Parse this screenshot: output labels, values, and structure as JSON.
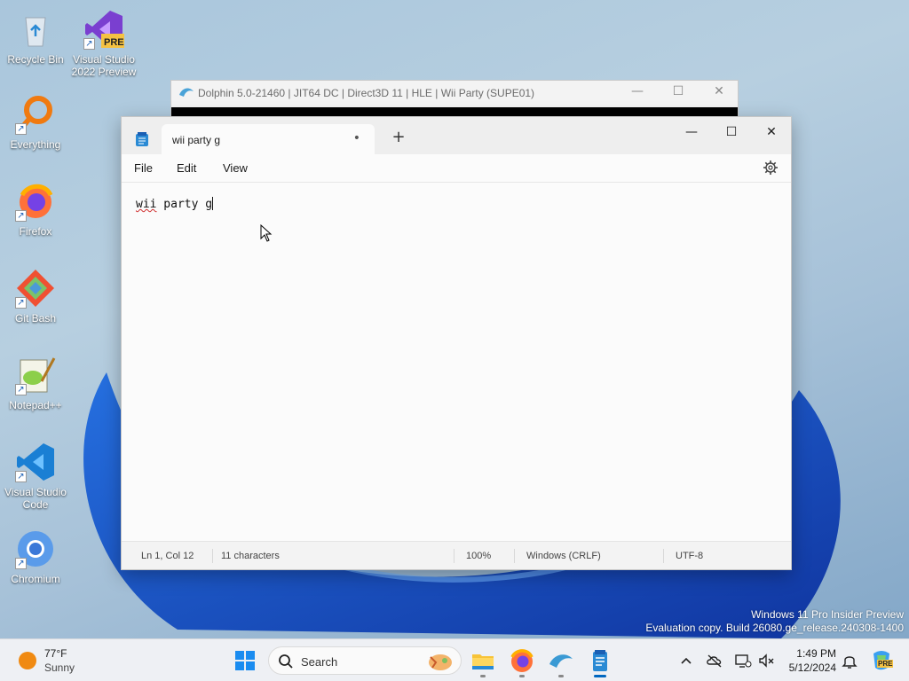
{
  "desktop": {
    "icons": [
      {
        "label": "Recycle Bin"
      },
      {
        "label": "Visual Studio 2022 Preview",
        "badge": "PRE"
      },
      {
        "label": "Everything"
      },
      {
        "label": "Firefox"
      },
      {
        "label": "Git Bash"
      },
      {
        "label": "Notepad++"
      },
      {
        "label": "Visual Studio Code"
      },
      {
        "label": "Chromium"
      }
    ]
  },
  "dolphin_window": {
    "title": "Dolphin 5.0-21460 | JIT64 DC | Direct3D 11 | HLE | Wii Party (SUPE01)",
    "minimize": "—",
    "maximize": "☐",
    "close": "✕"
  },
  "notepad": {
    "tab_title": "wii party g",
    "unsaved_indicator": "•",
    "new_tab": "+",
    "window_controls": {
      "minimize": "—",
      "maximize": "☐",
      "close": "✕"
    },
    "menu": {
      "file": "File",
      "edit": "Edit",
      "view": "View"
    },
    "content": {
      "word1": "wii",
      "rest": " party g"
    },
    "status": {
      "position": "Ln 1, Col 12",
      "characters": "11 characters",
      "zoom": "100%",
      "line_ending": "Windows (CRLF)",
      "encoding": "UTF-8"
    }
  },
  "watermark": {
    "line1": "Windows 11 Pro Insider Preview",
    "line2": "Evaluation copy. Build 26080.ge_release.240308-1400"
  },
  "taskbar": {
    "weather": {
      "temp": "77°F",
      "condition": "Sunny"
    },
    "search_placeholder": "Search",
    "clock": {
      "time": "1:49 PM",
      "date": "5/12/2024"
    },
    "tray_badge": "PRE"
  },
  "colors": {
    "accent": "#0067c0",
    "weather_sun": "#f08a12",
    "spell_error": "#d03030"
  }
}
